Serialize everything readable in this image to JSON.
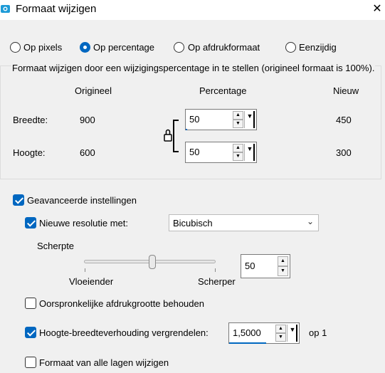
{
  "window": {
    "title": "Formaat wijzigen",
    "app_icon": "app-icon",
    "close_icon": "close-icon"
  },
  "modes": [
    {
      "label": "Op pixels",
      "selected": false
    },
    {
      "label": "Op percentage",
      "selected": true
    },
    {
      "label": "Op afdrukformaat",
      "selected": false
    },
    {
      "label": "Eenzijdig",
      "selected": false
    }
  ],
  "group": {
    "caption": "Formaat wijzigen door een wijzigingspercentage in te stellen (origineel formaat  is 100%).",
    "col_original": "Origineel",
    "col_percentage": "Percentage",
    "col_new": "Nieuw",
    "width_label": "Breedte:",
    "width_original": "900",
    "width_percentage": "50",
    "width_new": "450",
    "height_label": "Hoogte:",
    "height_original": "600",
    "height_percentage": "50",
    "height_new": "300",
    "lock_icon": "lock-icon"
  },
  "advanced": {
    "label": "Geavanceerde instellingen",
    "checked": true,
    "resample_label": "Nieuwe resolutie met:",
    "resample_checked": true,
    "resample_method": "Bicubisch",
    "sharpness_label": "Scherpte",
    "sharpness_value": "50",
    "slider_min_label": "Vloeiender",
    "slider_max_label": "Scherper",
    "slider_level": 0.5
  },
  "options": {
    "keep_print_size_label": "Oorspronkelijke afdrukgrootte behouden",
    "keep_print_size_checked": false,
    "lock_ratio_label": "Hoogte-breedteverhouding vergrendelen:",
    "lock_ratio_checked": true,
    "ratio_value": "1,5000",
    "ratio_suffix": "op 1",
    "all_layers_label": "Formaat van alle lagen wijzigen",
    "all_layers_checked": false
  },
  "colors": {
    "accent": "#0067c0",
    "background": "#f0f0f0"
  }
}
